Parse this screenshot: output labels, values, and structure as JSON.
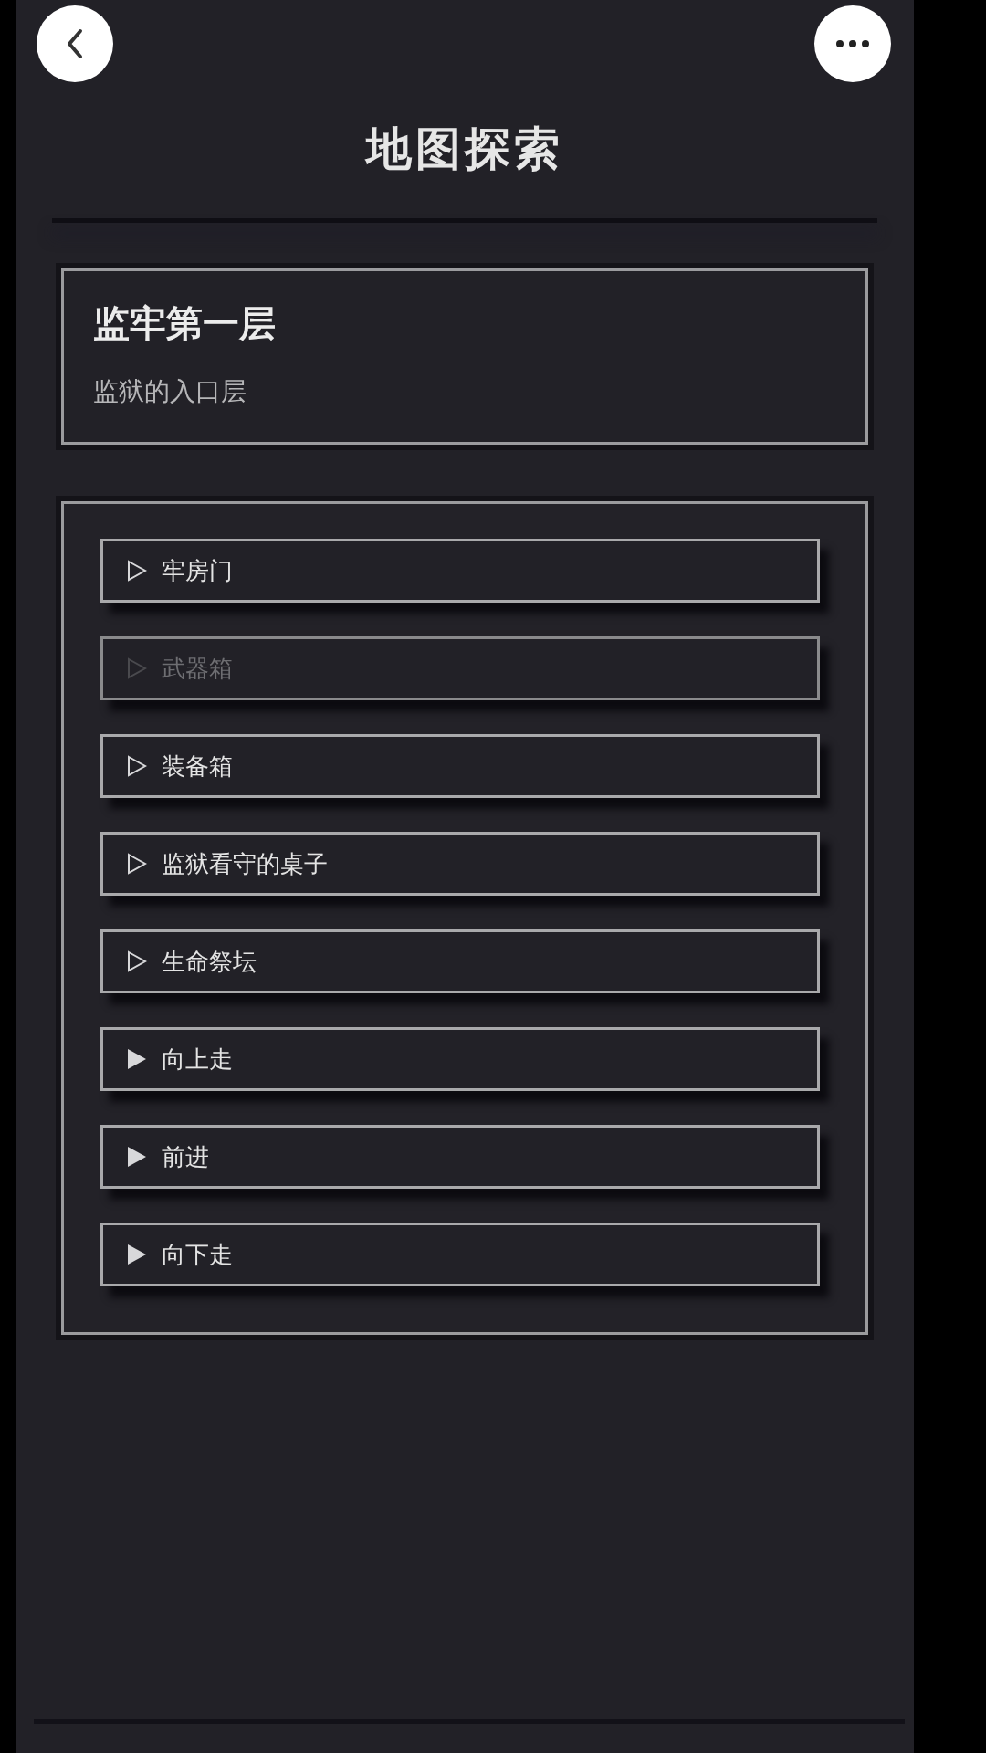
{
  "header": {
    "title": "地图探索"
  },
  "location": {
    "name": "监牢第一层",
    "description": "监狱的入口层"
  },
  "actions": [
    {
      "label": "牢房门",
      "kind": "interact",
      "disabled": false
    },
    {
      "label": "武器箱",
      "kind": "interact",
      "disabled": true
    },
    {
      "label": "装备箱",
      "kind": "interact",
      "disabled": false
    },
    {
      "label": "监狱看守的桌子",
      "kind": "interact",
      "disabled": false
    },
    {
      "label": "生命祭坛",
      "kind": "interact",
      "disabled": false
    },
    {
      "label": "向上走",
      "kind": "move",
      "disabled": false
    },
    {
      "label": "前进",
      "kind": "move",
      "disabled": false
    },
    {
      "label": "向下走",
      "kind": "move",
      "disabled": false
    }
  ]
}
